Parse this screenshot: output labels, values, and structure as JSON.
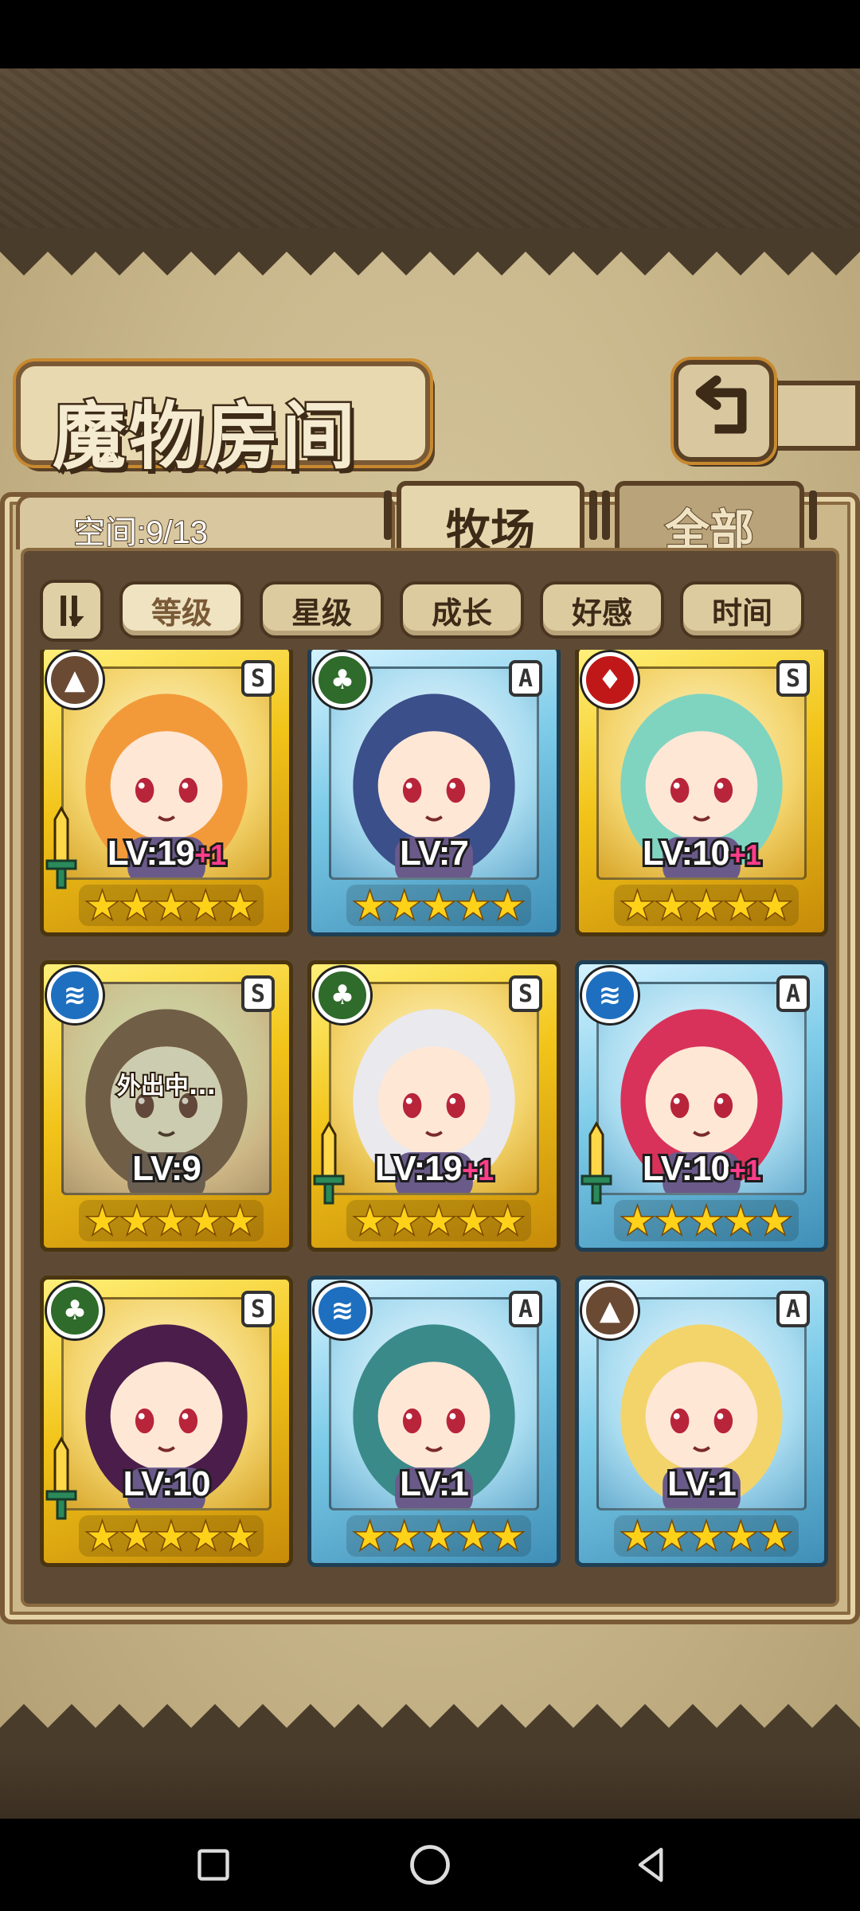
{
  "screen": {
    "title": "魔物房间",
    "space_label": "空间:9/13",
    "tabs": [
      {
        "label": "牧场",
        "active": true
      },
      {
        "label": "全部",
        "active": false
      }
    ],
    "sort_buttons": [
      {
        "label": "等级",
        "active": true
      },
      {
        "label": "星级",
        "active": false
      },
      {
        "label": "成长",
        "active": false
      },
      {
        "label": "好感",
        "active": false
      },
      {
        "label": "时间",
        "active": false
      }
    ]
  },
  "monsters": [
    {
      "element": "earth",
      "rank": "S",
      "frame": "gold",
      "level": "LV:19",
      "bonus": "+1",
      "weapon": true,
      "away": ""
    },
    {
      "element": "wood",
      "rank": "A",
      "frame": "blue",
      "level": "LV:7",
      "bonus": "",
      "weapon": false,
      "away": ""
    },
    {
      "element": "fire",
      "rank": "S",
      "frame": "gold",
      "level": "LV:10",
      "bonus": "+1",
      "weapon": false,
      "away": ""
    },
    {
      "element": "water",
      "rank": "S",
      "frame": "gold",
      "level": "LV:9",
      "bonus": "",
      "weapon": false,
      "away": "外出中..."
    },
    {
      "element": "wood",
      "rank": "S",
      "frame": "gold",
      "level": "LV:19",
      "bonus": "+1",
      "weapon": true,
      "away": ""
    },
    {
      "element": "water",
      "rank": "A",
      "frame": "blue",
      "level": "LV:10",
      "bonus": "+1",
      "weapon": true,
      "away": ""
    },
    {
      "element": "wood",
      "rank": "S",
      "frame": "gold",
      "level": "LV:10",
      "bonus": "",
      "weapon": true,
      "away": ""
    },
    {
      "element": "water",
      "rank": "A",
      "frame": "blue",
      "level": "LV:1",
      "bonus": "",
      "weapon": false,
      "away": ""
    },
    {
      "element": "earth",
      "rank": "A",
      "frame": "blue",
      "level": "LV:1",
      "bonus": "",
      "weapon": false,
      "away": ""
    }
  ],
  "element_icons": {
    "earth": "mountain-icon",
    "wood": "leaf-icon",
    "fire": "flame-icon",
    "water": "water-waves-icon"
  },
  "colors": {
    "gold_frame": "#f2c419",
    "blue_frame": "#7ccbe8",
    "level_bonus": "#ff3d8b",
    "star": "#ffd21a"
  },
  "stars_per_card": 5,
  "nav": {
    "recents": "recents-square-icon",
    "home": "home-circle-icon",
    "back": "back-triangle-icon"
  }
}
